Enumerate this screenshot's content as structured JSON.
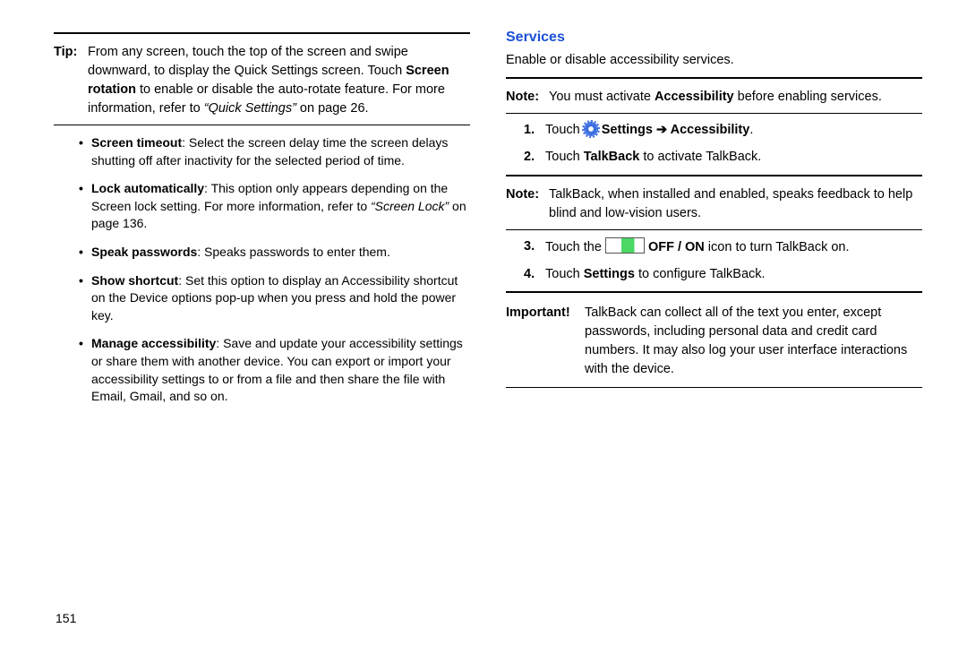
{
  "left": {
    "tip_label": "Tip:",
    "tip_p1": "From any screen, touch the top of the screen and swipe downward, to display the Quick Settings screen. Touch ",
    "tip_bold": "Screen rotation",
    "tip_p2": " to enable or disable the auto-rotate feature. For more information, refer to ",
    "tip_ref": "“Quick Settings”",
    "tip_p3": " on page 26.",
    "bullets": [
      {
        "bold": "Screen timeout",
        "rest": ": Select the screen delay time the screen delays shutting off after inactivity for the selected period of time."
      },
      {
        "bold": "Lock automatically",
        "rest": ": This option only appears depending on the Screen lock setting. For more information, refer to ",
        "ref": "“Screen Lock”",
        "rest2": " on page 136."
      },
      {
        "bold": "Speak passwords",
        "rest": ": Speaks passwords to enter them."
      },
      {
        "bold": "Show shortcut",
        "rest": ": Set this option to display an Accessibility shortcut on the Device options pop-up when you press and hold the power key."
      },
      {
        "bold": "Manage accessibility",
        "rest": ": Save and update your accessibility settings or share them with another device. You can export or import your accessibility settings to or from a file and then share the file with Email, Gmail, and so on."
      }
    ],
    "page_number": "151"
  },
  "right": {
    "heading": "Services",
    "intro": "Enable or disable accessibility services.",
    "note1_label": "Note:",
    "note1_a": "You must activate ",
    "note1_bold": "Accessibility",
    "note1_b": " before enabling services.",
    "step1_a": "Touch ",
    "step1_b": " Settings ",
    "step1_arrow": "➔",
    "step1_c": " Accessibility",
    "step1_d": ".",
    "step2_a": "Touch ",
    "step2_bold": "TalkBack",
    "step2_b": " to activate TalkBack.",
    "note2_label": "Note:",
    "note2_body": "TalkBack, when installed and enabled, speaks feedback to help blind and low-vision users.",
    "step3_a": "Touch the ",
    "step3_bold": " OFF / ON",
    "step3_b": " icon to turn TalkBack on.",
    "step4_a": "Touch ",
    "step4_bold": "Settings",
    "step4_b": " to configure TalkBack.",
    "imp_label": "Important!",
    "imp_body": "TalkBack can collect all of the text you enter, except passwords, including personal data and credit card numbers. It may also log your user interface interactions with the device."
  }
}
